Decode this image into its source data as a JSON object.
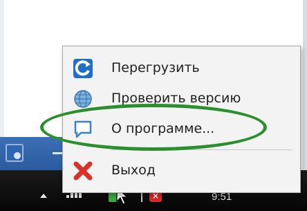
{
  "menu": {
    "items": [
      {
        "label": "Перегрузить",
        "icon": "refresh-icon"
      },
      {
        "label": "Проверить версию",
        "icon": "globe-icon"
      },
      {
        "label": "О программе...",
        "icon": "speech-bubble-icon"
      },
      {
        "label": "Выход",
        "icon": "red-x-icon"
      }
    ]
  },
  "taskbar": {
    "clock": "9:51",
    "tray_red_label": "×"
  },
  "colors": {
    "highlight_ellipse": "#2c8f2e",
    "window_bar": "#2b5b9f",
    "taskbar": "#050505"
  }
}
